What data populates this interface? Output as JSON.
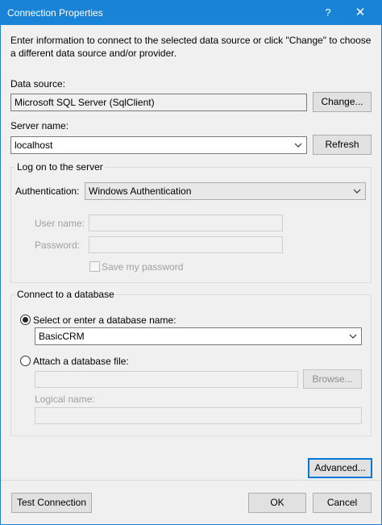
{
  "window": {
    "title": "Connection Properties",
    "help_glyph": "?",
    "close_glyph": "✕"
  },
  "intro_text": "Enter information to connect to the selected data source or click \"Change\" to choose a different data source and/or provider.",
  "data_source": {
    "label": "Data source:",
    "value": "Microsoft SQL Server (SqlClient)",
    "change_button": "Change..."
  },
  "server": {
    "label": "Server name:",
    "value": "localhost",
    "refresh_button": "Refresh"
  },
  "logon": {
    "group_title": "Log on to the server",
    "auth_label": "Authentication:",
    "auth_value": "Windows Authentication",
    "username_label": "User name:",
    "username_value": "",
    "password_label": "Password:",
    "password_value": "",
    "save_password_label": "Save my password",
    "save_password_checked": false
  },
  "database": {
    "group_title": "Connect to a database",
    "select_option_label": "Select or enter a database name:",
    "select_option_selected": true,
    "database_name": "BasicCRM",
    "attach_option_label": "Attach a database file:",
    "attach_option_selected": false,
    "attach_file_value": "",
    "browse_button": "Browse...",
    "logical_name_label": "Logical name:",
    "logical_name_value": ""
  },
  "advanced_button": "Advanced...",
  "footer": {
    "test_button": "Test Connection",
    "ok_button": "OK",
    "cancel_button": "Cancel"
  },
  "colors": {
    "titlebar": "#1883d7",
    "dialog_bg": "#f0f0f0",
    "focus_border": "#0078d7"
  }
}
